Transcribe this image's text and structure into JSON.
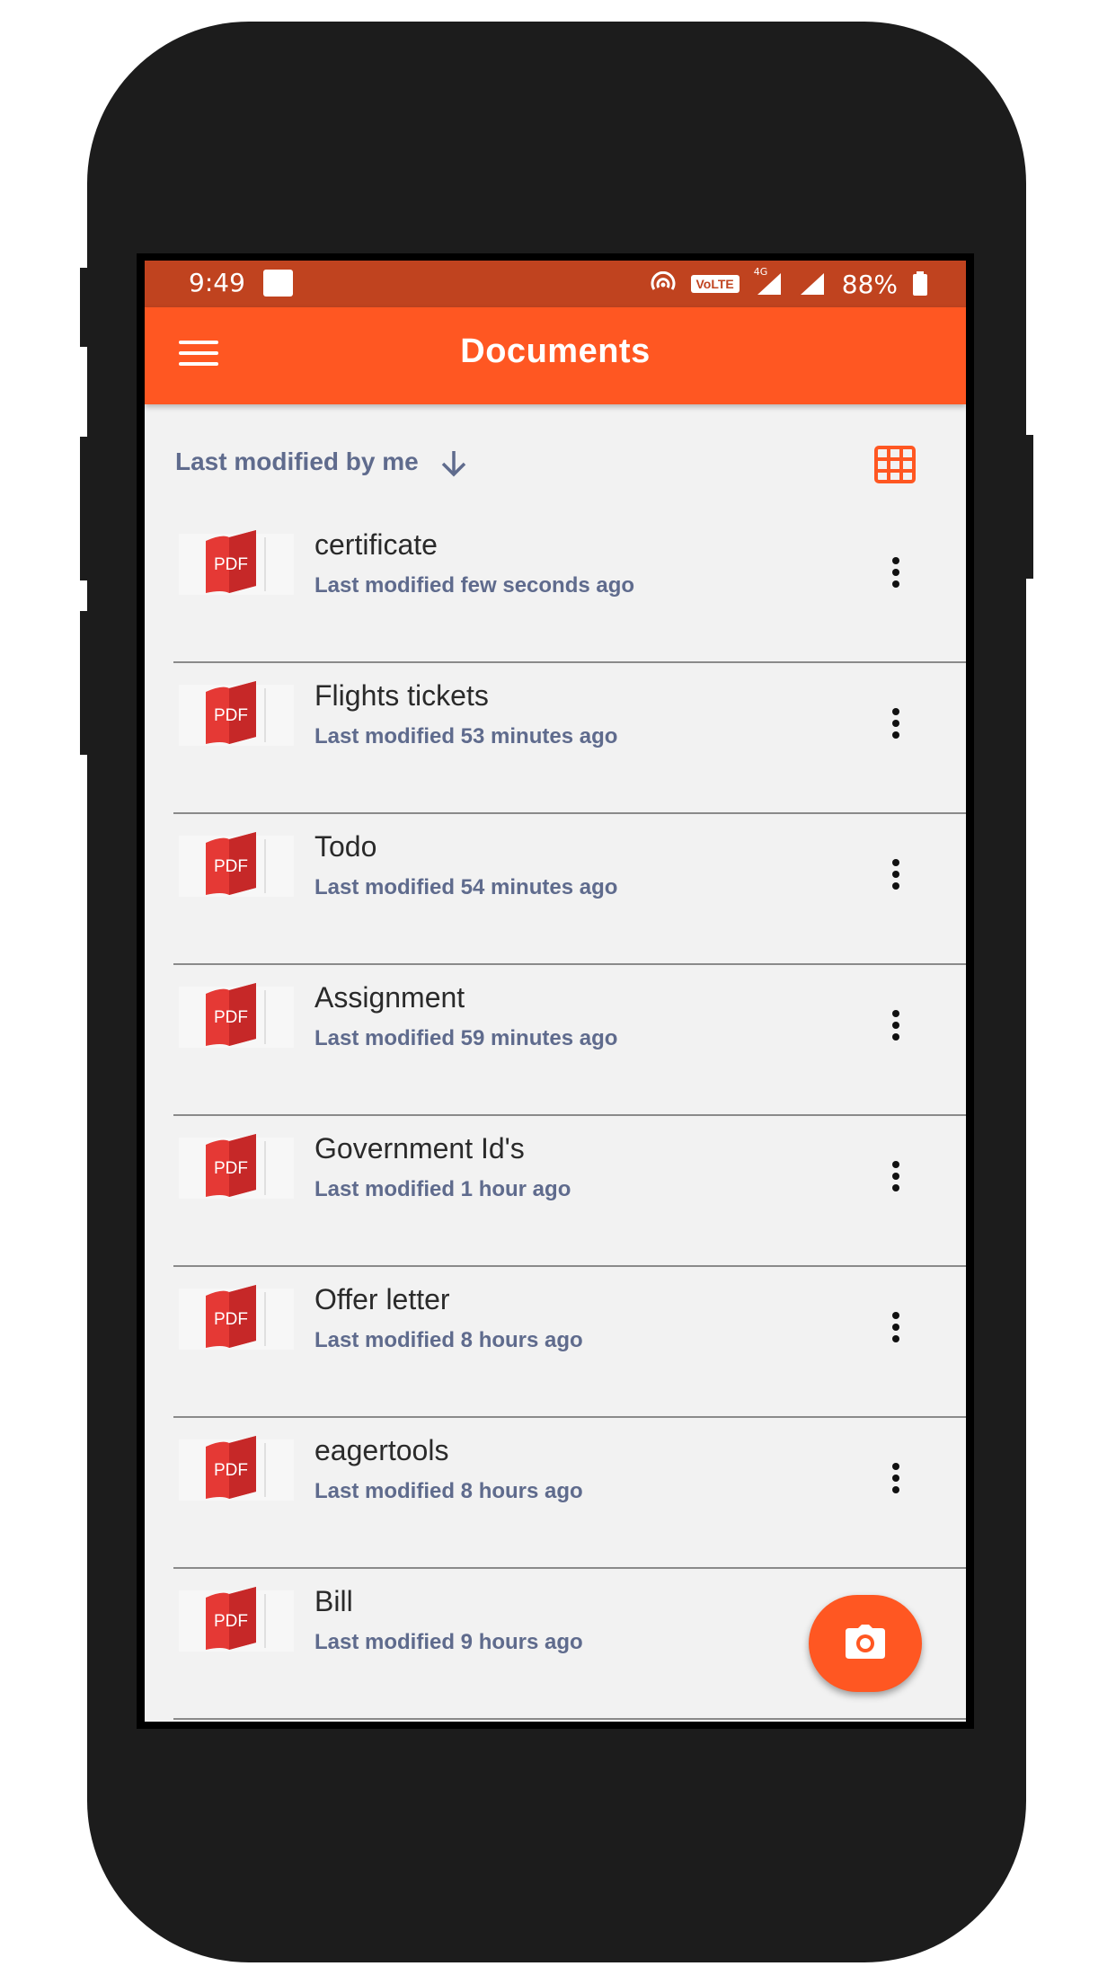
{
  "status_bar": {
    "time": "9:49",
    "network_label": "VoLTE",
    "net_type": "4G",
    "battery": "88%"
  },
  "app_bar": {
    "title": "Documents",
    "menu_icon": "hamburger-menu-icon"
  },
  "sort": {
    "label": "Last modified by me",
    "arrow_icon": "arrow-down-icon",
    "view_icon": "grid-view-icon"
  },
  "documents": [
    {
      "title": "certificate",
      "subtitle": "Last modified few seconds ago",
      "type": "PDF"
    },
    {
      "title": "Flights tickets",
      "subtitle": "Last modified 53 minutes ago",
      "type": "PDF"
    },
    {
      "title": "Todo",
      "subtitle": "Last modified 54 minutes ago",
      "type": "PDF"
    },
    {
      "title": "Assignment",
      "subtitle": "Last modified 59 minutes ago",
      "type": "PDF"
    },
    {
      "title": "Government Id's",
      "subtitle": "Last modified 1 hour ago",
      "type": "PDF"
    },
    {
      "title": "Offer letter",
      "subtitle": "Last modified 8 hours ago",
      "type": "PDF"
    },
    {
      "title": "eagertools",
      "subtitle": "Last modified 8 hours ago",
      "type": "PDF"
    },
    {
      "title": "Bill",
      "subtitle": "Last modified 9 hours ago",
      "type": "PDF"
    }
  ],
  "fab": {
    "icon": "camera-icon"
  },
  "colors": {
    "accent": "#ff5722",
    "status_bar": "#c0431f",
    "pdf_red": "#d32f2f",
    "subtitle": "#5f6b8d",
    "phone_body": "#1c1c1c"
  }
}
